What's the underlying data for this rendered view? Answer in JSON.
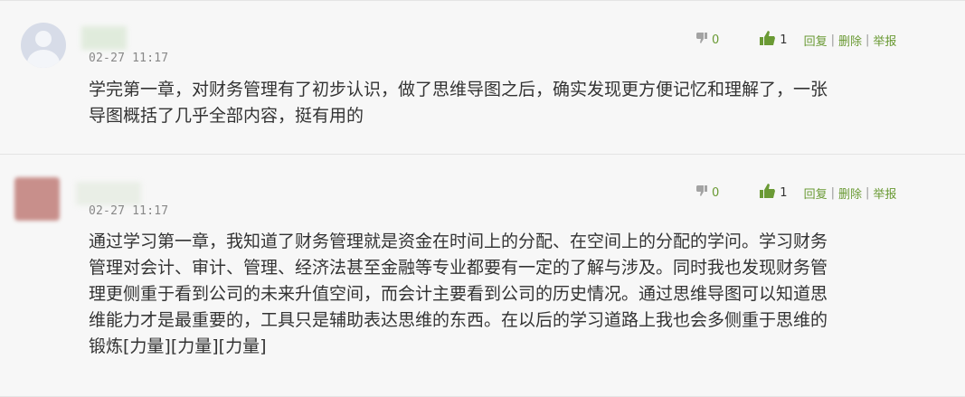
{
  "comments": [
    {
      "date": "02-27 11:17",
      "dislike_count": "0",
      "like_count": "1",
      "actions": [
        "回复",
        "删除",
        "举报"
      ],
      "separator": "|",
      "lines": [
        "学完第一章，对财务管理有了初步认识，做了思维导图之后，确实发现更方便记忆和理解了，一张",
        "导图概括了几乎全部内容，挺有用的"
      ]
    },
    {
      "date": "02-27 11:17",
      "dislike_count": "0",
      "like_count": "1",
      "actions": [
        "回复",
        "删除",
        "举报"
      ],
      "separator": "|",
      "lines": [
        "通过学习第一章，我知道了财务管理就是资金在时间上的分配、在空间上的分配的学问。学习财务",
        "管理对会计、审计、管理、经济法甚至金融等专业都要有一定的了解与涉及。同时我也发现财务管",
        "理更侧重于看到公司的未来升值空间，而会计主要看到公司的历史情况。通过思维导图可以知道思",
        "维能力才是最重要的，工具只是辅助表达思维的东西。在以后的学习道路上我也会多侧重于思维的",
        "锻炼[力量][力量][力量]"
      ]
    }
  ],
  "colors": {
    "link": "#6a9a34",
    "text": "#333333",
    "date": "#888888",
    "background": "#f7f7f7"
  }
}
